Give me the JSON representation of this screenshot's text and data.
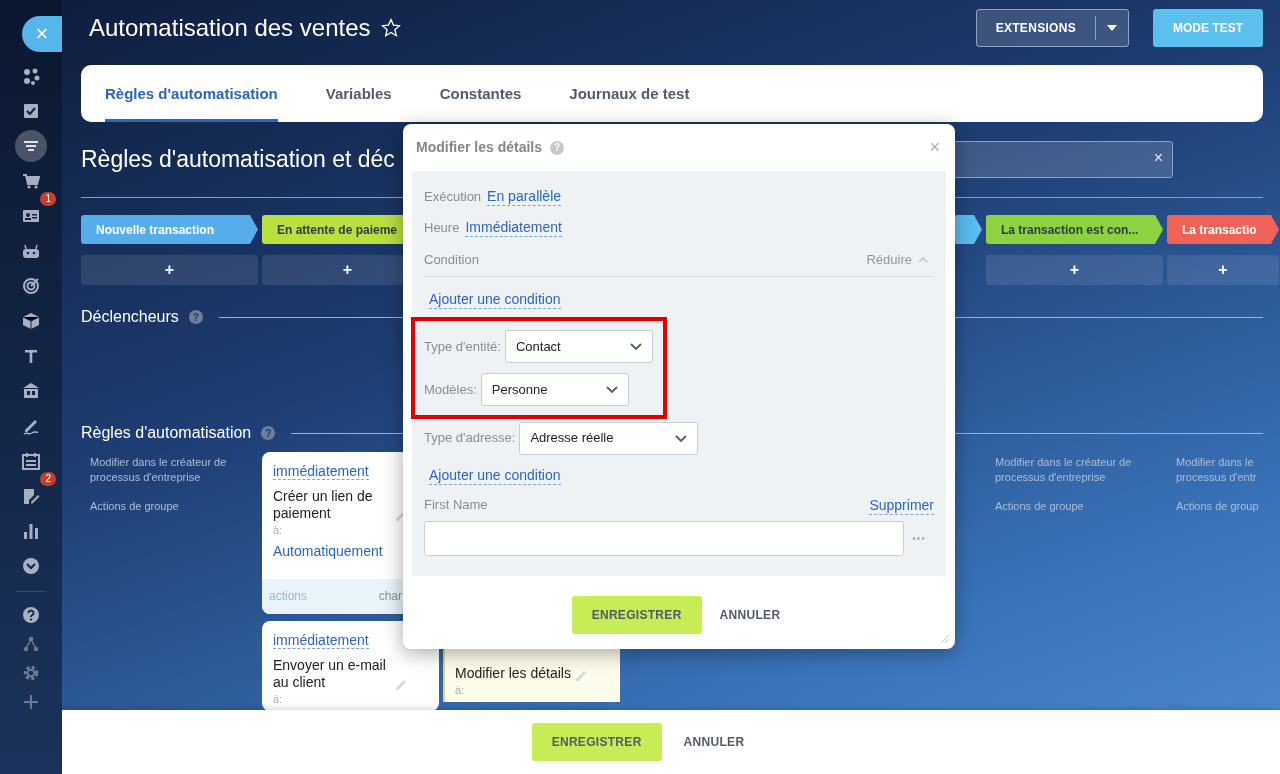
{
  "sidebar": {
    "close": "×",
    "items": [
      {
        "selected": false
      },
      {
        "selected": false
      },
      {
        "selected": true
      },
      {
        "selected": false
      },
      {
        "selected": false,
        "badge": "1"
      },
      {
        "selected": false
      },
      {
        "selected": false
      },
      {
        "selected": false
      },
      {
        "selected": false
      },
      {
        "selected": false
      },
      {
        "selected": false
      },
      {
        "selected": false
      },
      {
        "selected": false,
        "badge": "2"
      },
      {
        "selected": false
      },
      {
        "selected": false
      }
    ],
    "bottom_items": [
      {
        "selected": false
      },
      {
        "selected": false
      },
      {
        "selected": false
      },
      {
        "selected": false
      }
    ]
  },
  "header": {
    "title": "Automatisation des ventes",
    "extensions": "EXTENSIONS",
    "test_mode": "MODE TEST"
  },
  "tabs": [
    {
      "label": "Règles d'automatisation",
      "selected": true
    },
    {
      "label": "Variables",
      "selected": false
    },
    {
      "label": "Constantes",
      "selected": false
    },
    {
      "label": "Journaux de test",
      "selected": false
    }
  ],
  "section_title": "Règles d'automatisation et déc",
  "search": {
    "clear": "×"
  },
  "stages": [
    {
      "label": "Nouvelle transaction",
      "color": "#55aeea"
    },
    {
      "label": "En attente de paieme",
      "color": "#b8e03f"
    },
    {
      "color": "#5bbcf0"
    },
    {
      "label": "La transaction est con...",
      "color": "#8dd340"
    },
    {
      "label": "La transactio",
      "color": "#ee6257"
    }
  ],
  "add_buttons": [
    "+",
    "+",
    "+",
    "+"
  ],
  "triggers": {
    "title": "Déclencheurs",
    "help": "?"
  },
  "rules": {
    "title": "Règles d'automatisation",
    "help": "?",
    "columns": [
      {
        "kind": "links",
        "items": [
          "Modifier dans le créateur de processus d'entreprise",
          "Actions de groupe"
        ]
      },
      {
        "kind": "cards",
        "cards": [
          {
            "timing": "immédiatement",
            "name": "Créer un lien de paiement",
            "to_label": "à:",
            "to": "Automatiquement",
            "footer": [
              "actions",
              "char"
            ]
          },
          {
            "timing": "immédiatement",
            "name": "Envoyer un e-mail au client",
            "to_label": "à:"
          }
        ]
      },
      {
        "kind": "cards",
        "cards": [
          {
            "name": "Modifier les détails",
            "to_label": "à:",
            "active": true
          }
        ]
      },
      {
        "kind": "links",
        "items": [
          "Modifier dans le créateur de processus d'entreprise",
          "Actions de groupe"
        ]
      },
      {
        "kind": "links",
        "items": [
          "Modifier dans le",
          "processus d'entr",
          "Actions de group"
        ]
      }
    ]
  },
  "modal": {
    "title": "Modifier les détails",
    "help": "?",
    "close": "×",
    "settings": [
      {
        "label": "Exécution",
        "value": "En parallèle"
      },
      {
        "label": "Heure",
        "value": "Immédiatement"
      }
    ],
    "condition": {
      "label": "Condition",
      "collapse": "Réduire",
      "add": "Ajouter une condition"
    },
    "conditions": [
      {
        "label": "Type d'entité:",
        "value": "Contact",
        "highlighted": true
      },
      {
        "label": "Modèles:",
        "value": "Personne",
        "highlighted": true
      },
      {
        "label": "Type d'adresse:",
        "value": "Adresse réelle",
        "highlighted": false
      }
    ],
    "add_condition": "Ajouter une condition",
    "field": {
      "label": "First Name",
      "remove": "Supprimer",
      "more": "•••"
    },
    "save": "ENREGISTRER",
    "cancel": "ANNULER"
  },
  "footer": {
    "save": "ENREGISTRER",
    "cancel": "ANNULER"
  }
}
